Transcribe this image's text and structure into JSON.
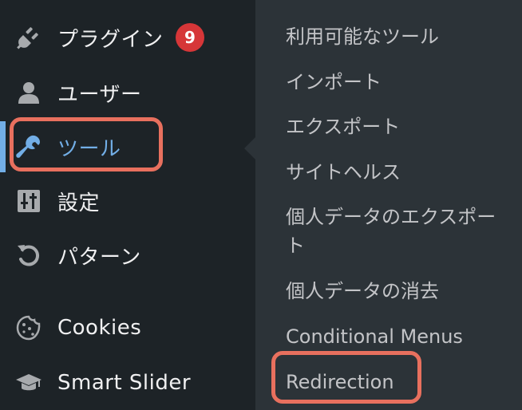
{
  "sidebar": {
    "items": [
      {
        "label": "プラグイン",
        "icon": "plug-icon",
        "badge": "9"
      },
      {
        "label": "ユーザー",
        "icon": "user-icon"
      },
      {
        "label": "ツール",
        "icon": "wrench-icon",
        "active": true
      },
      {
        "label": "設定",
        "icon": "sliders-icon"
      },
      {
        "label": "パターン",
        "icon": "undo-icon"
      },
      {
        "label": "Cookies",
        "icon": "cookie-icon"
      },
      {
        "label": "Smart Slider",
        "icon": "graduation-cap-icon"
      }
    ]
  },
  "submenu": {
    "items": [
      "利用可能なツール",
      "インポート",
      "エクスポート",
      "サイトヘルス",
      "個人データのエクスポート",
      "個人データの消去",
      "Conditional Menus",
      "Redirection"
    ]
  },
  "colors": {
    "sidebar_bg": "#1d2327",
    "submenu_bg": "#2c3338",
    "active_text": "#72aee6",
    "badge": "#d63638",
    "highlight_ring": "#e8705e"
  }
}
